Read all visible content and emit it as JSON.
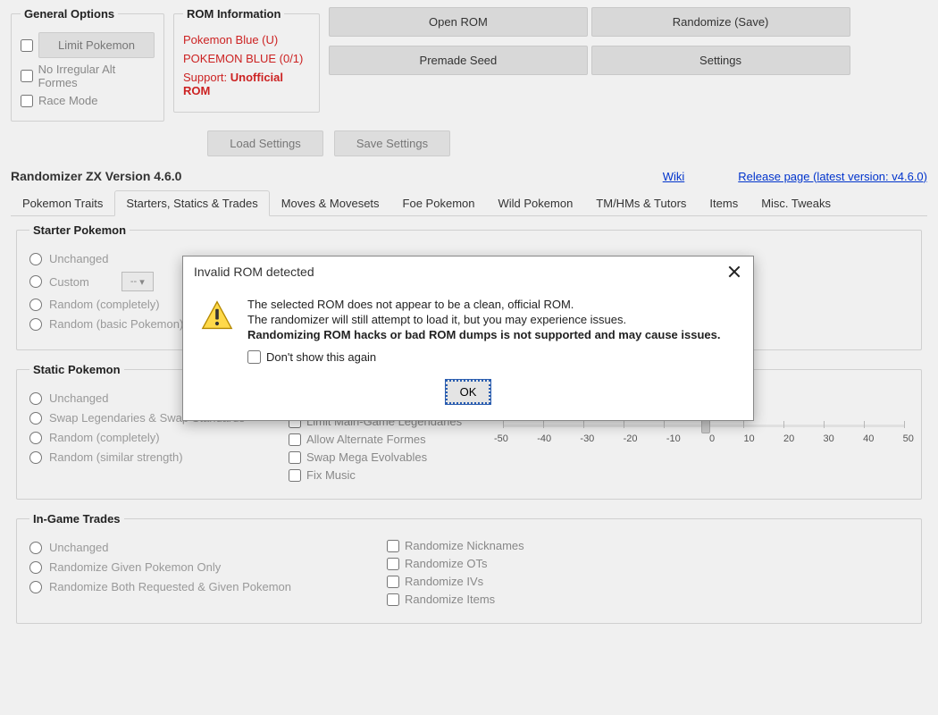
{
  "general_options": {
    "legend": "General Options",
    "limit_btn": "Limit Pokemon",
    "irregular": "No Irregular Alt Formes",
    "race": "Race Mode"
  },
  "rom_info": {
    "legend": "ROM Information",
    "name": "Pokemon Blue (U)",
    "code": "POKEMON BLUE (0/1)",
    "support_label": "Support:",
    "support_value": "Unofficial ROM"
  },
  "right_buttons": {
    "open": "Open ROM",
    "randomize": "Randomize (Save)",
    "premade": "Premade Seed",
    "settings": "Settings"
  },
  "settings_buttons": {
    "load": "Load Settings",
    "save": "Save Settings"
  },
  "app_title": "Randomizer ZX Version 4.6.0",
  "links": {
    "wiki": "Wiki",
    "release": "Release page (latest version: v4.6.0)"
  },
  "tabs": [
    "Pokemon Traits",
    "Starters, Statics & Trades",
    "Moves & Movesets",
    "Foe Pokemon",
    "Wild Pokemon",
    "TM/HMs & Tutors",
    "Items",
    "Misc. Tweaks"
  ],
  "starter": {
    "legend": "Starter Pokemon",
    "opts": [
      "Unchanged",
      "Custom",
      "Random (completely)",
      "Random (basic Pokemon)"
    ],
    "custom_sel": "--"
  },
  "static": {
    "legend": "Static Pokemon",
    "radios": [
      "Unchanged",
      "Swap Legendaries & Swap Standards",
      "Random (completely)",
      "Random (similar strength)"
    ],
    "checks": [
      "Limit Main-Game Legendaries",
      "Allow Alternate Formes",
      "Swap Mega Evolvables",
      "Fix Music"
    ],
    "slider_labels": [
      "-50",
      "-40",
      "-30",
      "-20",
      "-10",
      "0",
      "10",
      "20",
      "30",
      "40",
      "50"
    ]
  },
  "trades": {
    "legend": "In-Game Trades",
    "radios": [
      "Unchanged",
      "Randomize Given Pokemon Only",
      "Randomize Both Requested & Given Pokemon"
    ],
    "checks": [
      "Randomize Nicknames",
      "Randomize OTs",
      "Randomize IVs",
      "Randomize Items"
    ]
  },
  "dialog": {
    "title": "Invalid ROM detected",
    "line1": "The selected ROM does not appear to be a clean, official ROM.",
    "line2": "The randomizer will still attempt to load it, but you may experience issues.",
    "line3": "Randomizing ROM hacks or bad ROM dumps is not supported and may cause issues.",
    "dont_show": "Don't show this again",
    "ok": "OK"
  }
}
